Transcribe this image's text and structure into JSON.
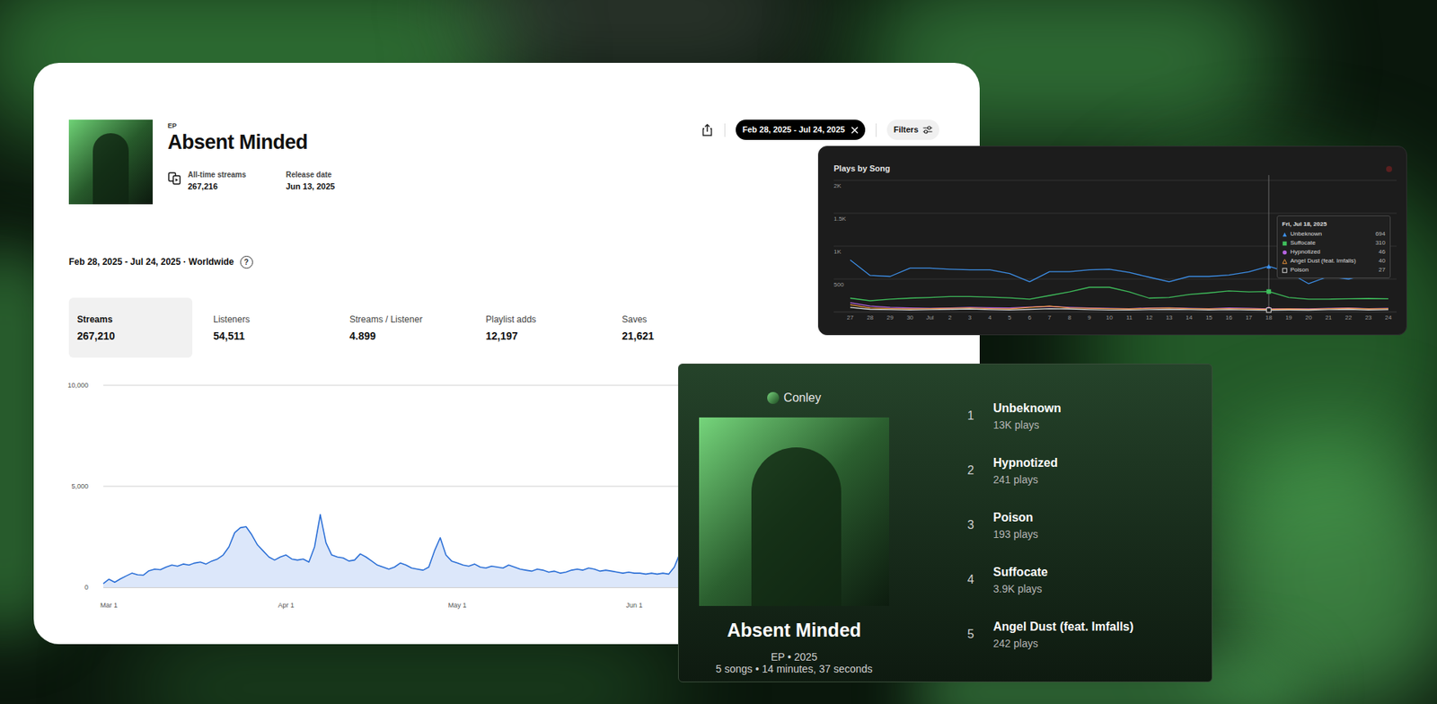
{
  "ep_panel": {
    "kind_label": "EP",
    "title": "Absent Minded",
    "all_time_streams": {
      "label": "All-time streams",
      "value": "267,216"
    },
    "release_date": {
      "label": "Release date",
      "value": "Jun 13, 2025"
    },
    "date_filter": "Feb 28, 2025 - Jul 24, 2025",
    "filters_button": "Filters",
    "range_heading": "Feb 28, 2025 - Jul 24, 2025 · Worldwide",
    "help": "?",
    "stats": [
      {
        "label": "Streams",
        "value": "267,210",
        "selected": true
      },
      {
        "label": "Listeners",
        "value": "54,511",
        "selected": false
      },
      {
        "label": "Streams / Listener",
        "value": "4.899",
        "selected": false
      },
      {
        "label": "Playlist adds",
        "value": "12,197",
        "selected": false
      },
      {
        "label": "Saves",
        "value": "21,621",
        "selected": false
      }
    ],
    "chart": {
      "y_ticks": [
        {
          "label": "10,000",
          "value": 10000
        },
        {
          "label": "5,000",
          "value": 5000
        },
        {
          "label": "0",
          "value": 0
        }
      ],
      "x_ticks": [
        {
          "label": "Mar 1",
          "index": 1
        },
        {
          "label": "Apr 1",
          "index": 32
        },
        {
          "label": "May 1",
          "index": 62
        },
        {
          "label": "Jun 1",
          "index": 93
        }
      ],
      "values": [
        180,
        400,
        250,
        420,
        560,
        700,
        620,
        600,
        820,
        900,
        870,
        1000,
        1100,
        1050,
        1150,
        1100,
        1200,
        1250,
        1150,
        1300,
        1400,
        1600,
        2000,
        2700,
        2950,
        3000,
        2600,
        2100,
        1800,
        1500,
        1350,
        1500,
        1600,
        1400,
        1350,
        1400,
        1250,
        2000,
        3600,
        2200,
        1600,
        1500,
        1450,
        1300,
        1350,
        1650,
        1500,
        1300,
        1100,
        1000,
        900,
        1000,
        1200,
        1100,
        950,
        900,
        850,
        1000,
        1800,
        2450,
        1600,
        1300,
        1200,
        1100,
        1050,
        1150,
        1000,
        950,
        1050,
        1000,
        950,
        1100,
        1000,
        900,
        850,
        800,
        900,
        850,
        750,
        800,
        700,
        750,
        850,
        900,
        850,
        950,
        900,
        800,
        850,
        800,
        750,
        700,
        750,
        700,
        700,
        650,
        700,
        650,
        700,
        650,
        1000,
        1700,
        2400
      ]
    }
  },
  "plays_by_song": {
    "title": "Plays by Song",
    "y_ticks": [
      {
        "label": "2K",
        "value": 2000
      },
      {
        "label": "1.5K",
        "value": 1500
      },
      {
        "label": "1K",
        "value": 1000
      },
      {
        "label": "500",
        "value": 500
      }
    ],
    "x_ticks": [
      "27",
      "28",
      "29",
      "30",
      "Jul",
      "2",
      "3",
      "4",
      "5",
      "6",
      "7",
      "8",
      "9",
      "10",
      "11",
      "12",
      "13",
      "14",
      "15",
      "16",
      "17",
      "18",
      "19",
      "20",
      "21",
      "22",
      "23",
      "24"
    ],
    "hover_index": 21,
    "series": [
      {
        "name": "Unbeknown",
        "color": "#3d8fe8",
        "kind": "triangle",
        "values": [
          790,
          555,
          540,
          667,
          667,
          650,
          640,
          640,
          583,
          458,
          611,
          611,
          640,
          650,
          600,
          528,
          458,
          540,
          540,
          560,
          610,
          694,
          600,
          430,
          540,
          500,
          580,
          570
        ]
      },
      {
        "name": "Suffocate",
        "color": "#3fbf5c",
        "kind": "square",
        "values": [
          210,
          170,
          195,
          210,
          220,
          235,
          235,
          225,
          215,
          195,
          250,
          305,
          375,
          375,
          305,
          210,
          220,
          265,
          290,
          320,
          305,
          310,
          220,
          195,
          195,
          200,
          205,
          200
        ]
      },
      {
        "name": "Hypnotized",
        "color": "#b463e0",
        "kind": "circle",
        "values": [
          140,
          90,
          70,
          60,
          55,
          60,
          70,
          65,
          60,
          75,
          85,
          70,
          60,
          55,
          50,
          60,
          65,
          55,
          50,
          60,
          55,
          46,
          50,
          45,
          55,
          60,
          50,
          55
        ]
      },
      {
        "name": "Angel Dust (feat. Imfalls)",
        "color": "#e8923a",
        "kind": "triangle-outline",
        "values": [
          110,
          60,
          50,
          45,
          50,
          55,
          60,
          50,
          45,
          70,
          90,
          60,
          55,
          50,
          45,
          55,
          60,
          50,
          45,
          50,
          45,
          40,
          45,
          40,
          50,
          55,
          45,
          50
        ]
      },
      {
        "name": "Poison",
        "color": "#d6d6d6",
        "kind": "square-outline",
        "values": [
          70,
          40,
          35,
          30,
          35,
          40,
          45,
          35,
          30,
          40,
          50,
          45,
          35,
          30,
          30,
          35,
          40,
          35,
          30,
          35,
          30,
          27,
          30,
          28,
          35,
          40,
          30,
          35
        ]
      }
    ],
    "tooltip": {
      "date": "Fri, Jul 18, 2025",
      "values": [
        "694",
        "310",
        "46",
        "40",
        "27"
      ]
    }
  },
  "album_card": {
    "artist": "Conley",
    "title": "Absent Minded",
    "meta": "EP • 2025",
    "summary": "5 songs • 14 minutes, 37 seconds",
    "tracks": [
      {
        "number": "1",
        "title": "Unbeknown",
        "plays": "13K plays"
      },
      {
        "number": "2",
        "title": "Hypnotized",
        "plays": "241 plays"
      },
      {
        "number": "3",
        "title": "Poison",
        "plays": "193 plays"
      },
      {
        "number": "4",
        "title": "Suffocate",
        "plays": "3.9K plays"
      },
      {
        "number": "5",
        "title": "Angel Dust (feat. Imfalls)",
        "plays": "242 plays"
      }
    ]
  }
}
